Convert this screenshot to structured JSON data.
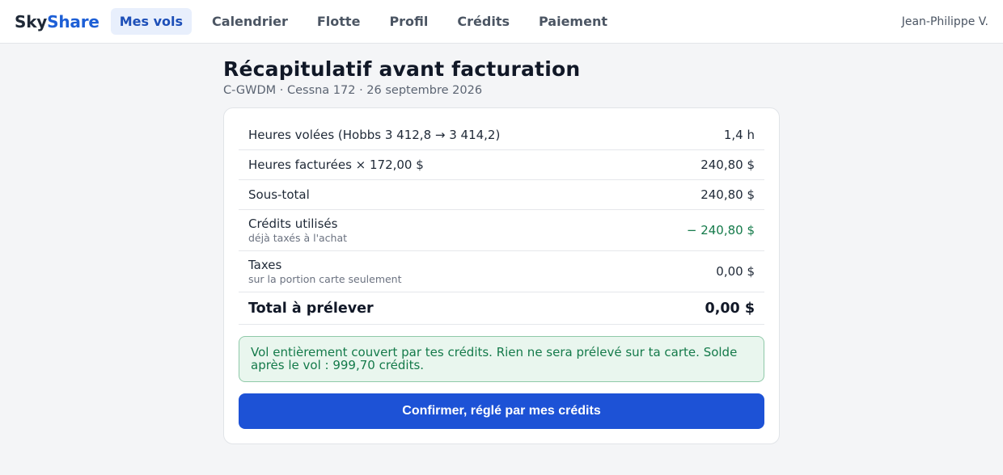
{
  "brand": {
    "part1": "Sky",
    "part2": "Share"
  },
  "nav": {
    "items": [
      {
        "label": "Mes vols"
      },
      {
        "label": "Calendrier"
      },
      {
        "label": "Flotte"
      },
      {
        "label": "Profil"
      },
      {
        "label": "Crédits"
      },
      {
        "label": "Paiement"
      }
    ]
  },
  "user": {
    "name": "Jean-Philippe V."
  },
  "page": {
    "title": "Récapitulatif avant facturation",
    "subtitle": "C-GWDM · Cessna 172 · 26 septembre 2026"
  },
  "summary": {
    "rows": [
      {
        "label": "Heures volées (Hobbs 3 412,8 → 3 414,2)",
        "value": "1,4 h"
      },
      {
        "label": "Heures facturées × 172,00 $",
        "value": "240,80 $"
      },
      {
        "label": "Sous-total",
        "value": "240,80 $"
      },
      {
        "label": "Crédits utilisés",
        "sub": "déjà taxés à l'achat",
        "value": "− 240,80 $"
      },
      {
        "label": "Taxes",
        "sub": "sur la portion carte seulement",
        "value": "0,00 $"
      }
    ],
    "total": {
      "label": "Total à prélever",
      "value": "0,00 $"
    }
  },
  "notice": {
    "text": "Vol entièrement couvert par tes crédits. Rien ne sera prélevé sur ta carte. Solde après le vol : 999,70 crédits."
  },
  "confirm": {
    "label": "Confirmer, réglé par mes crédits"
  },
  "colors": {
    "accent": "#1d52d6",
    "credit": "#147a4a",
    "notice_bg": "#e9f6ee"
  }
}
